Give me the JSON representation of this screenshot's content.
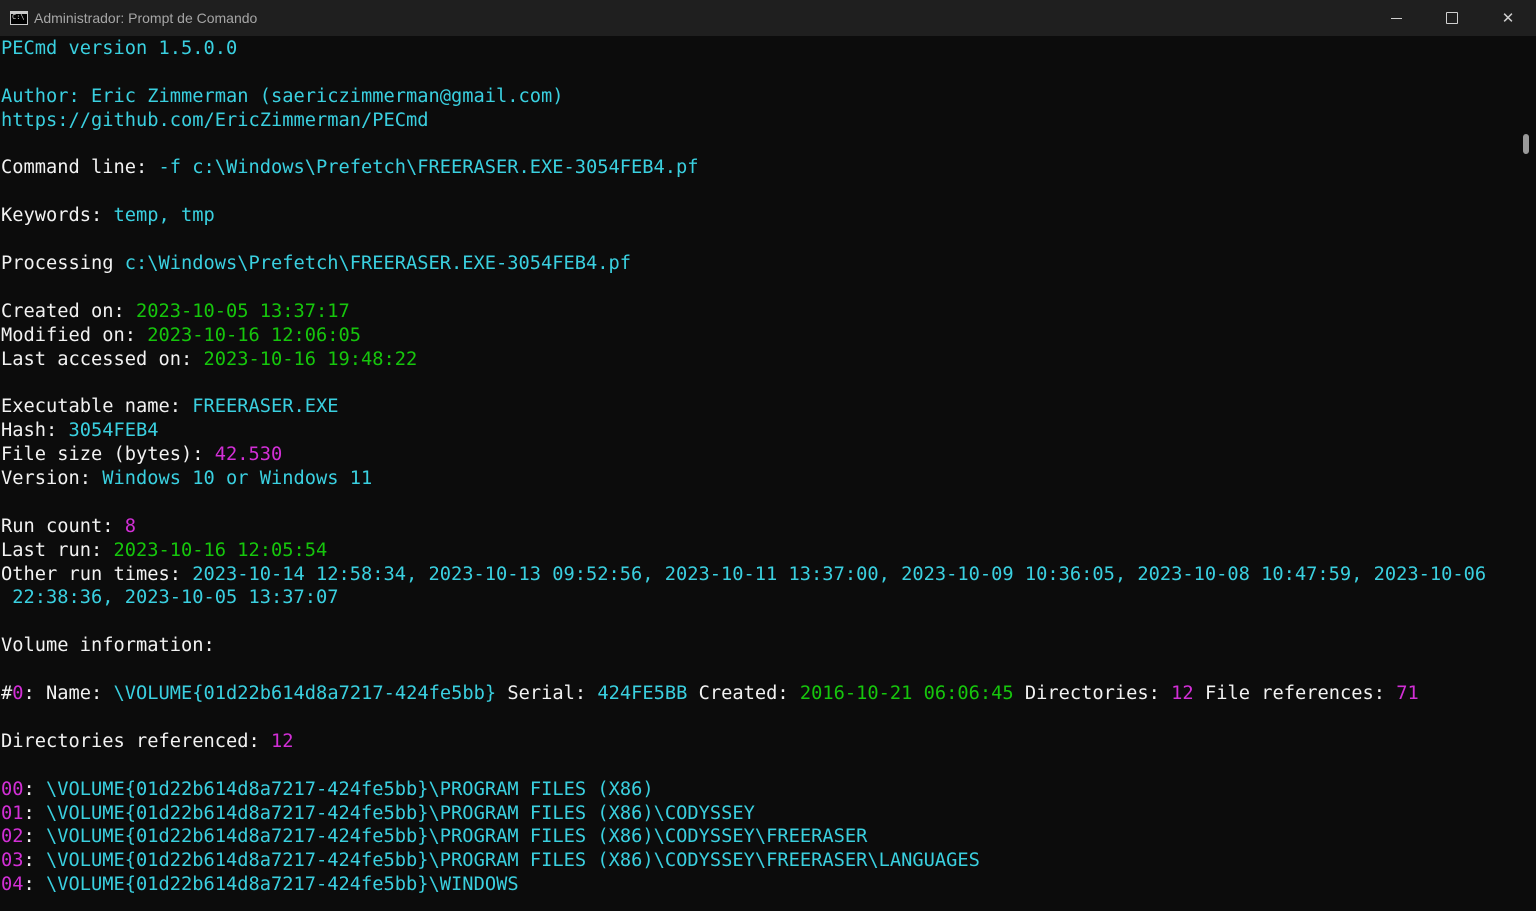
{
  "window": {
    "title": "Administrador: Prompt de Comando",
    "icon": "command-prompt-icon",
    "controls": {
      "minimize": "minimize-icon",
      "maximize": "maximize-icon",
      "close": "close-icon",
      "close_glyph": "✕"
    }
  },
  "colors": {
    "background": "#0c0c0c",
    "text": "#f2f2f2",
    "cyan": "#3ad0e0",
    "green": "#16c60c",
    "magenta": "#d22fd6"
  },
  "console": {
    "lines": [
      [
        {
          "t": "PECmd version 1.5.0.0",
          "c": "cyan"
        }
      ],
      [],
      [
        {
          "t": "Author: Eric Zimmerman (saericzimmerman@gmail.com)",
          "c": "cyan"
        }
      ],
      [
        {
          "t": "https://github.com/EricZimmerman/PECmd",
          "c": "cyan"
        }
      ],
      [],
      [
        {
          "t": "Command line: ",
          "c": "white"
        },
        {
          "t": "-f c:\\Windows\\Prefetch\\FREERASER.EXE-3054FEB4.pf",
          "c": "cyan"
        }
      ],
      [],
      [
        {
          "t": "Keywords: ",
          "c": "white"
        },
        {
          "t": "temp, tmp",
          "c": "cyan"
        }
      ],
      [],
      [
        {
          "t": "Processing ",
          "c": "white"
        },
        {
          "t": "c:\\Windows\\Prefetch\\FREERASER.EXE-3054FEB4.pf",
          "c": "cyan"
        }
      ],
      [],
      [
        {
          "t": "Created on: ",
          "c": "white"
        },
        {
          "t": "2023-10-05 13:37:17",
          "c": "green"
        }
      ],
      [
        {
          "t": "Modified on: ",
          "c": "white"
        },
        {
          "t": "2023-10-16 12:06:05",
          "c": "green"
        }
      ],
      [
        {
          "t": "Last accessed on: ",
          "c": "white"
        },
        {
          "t": "2023-10-16 19:48:22",
          "c": "green"
        }
      ],
      [],
      [
        {
          "t": "Executable name: ",
          "c": "white"
        },
        {
          "t": "FREERASER.EXE",
          "c": "cyan"
        }
      ],
      [
        {
          "t": "Hash: ",
          "c": "white"
        },
        {
          "t": "3054FEB4",
          "c": "cyan"
        }
      ],
      [
        {
          "t": "File size (bytes): ",
          "c": "white"
        },
        {
          "t": "42.530",
          "c": "magenta"
        }
      ],
      [
        {
          "t": "Version: ",
          "c": "white"
        },
        {
          "t": "Windows 10 or Windows 11",
          "c": "cyan"
        }
      ],
      [],
      [
        {
          "t": "Run count: ",
          "c": "white"
        },
        {
          "t": "8",
          "c": "magenta"
        }
      ],
      [
        {
          "t": "Last run: ",
          "c": "white"
        },
        {
          "t": "2023-10-16 12:05:54",
          "c": "green"
        }
      ],
      [
        {
          "t": "Other run times: ",
          "c": "white"
        },
        {
          "t": "2023-10-14 12:58:34, 2023-10-13 09:52:56, 2023-10-11 13:37:00, 2023-10-09 10:36:05, 2023-10-08 10:47:59, 2023-10-06",
          "c": "cyan"
        }
      ],
      [
        {
          "t": " 22:38:36, 2023-10-05 13:37:07",
          "c": "cyan"
        }
      ],
      [],
      [
        {
          "t": "Volume information:",
          "c": "white"
        }
      ],
      [],
      [
        {
          "t": "#",
          "c": "white"
        },
        {
          "t": "0",
          "c": "magenta"
        },
        {
          "t": ": Name: ",
          "c": "white"
        },
        {
          "t": "\\VOLUME{01d22b614d8a7217-424fe5bb}",
          "c": "cyan"
        },
        {
          "t": " Serial: ",
          "c": "white"
        },
        {
          "t": "424FE5BB",
          "c": "cyan"
        },
        {
          "t": " Created: ",
          "c": "white"
        },
        {
          "t": "2016-10-21 06:06:45",
          "c": "green"
        },
        {
          "t": " Directories: ",
          "c": "white"
        },
        {
          "t": "12",
          "c": "magenta"
        },
        {
          "t": " File references: ",
          "c": "white"
        },
        {
          "t": "71",
          "c": "magenta"
        }
      ],
      [],
      [
        {
          "t": "Directories referenced: ",
          "c": "white"
        },
        {
          "t": "12",
          "c": "magenta"
        }
      ],
      [],
      [
        {
          "t": "00",
          "c": "magenta"
        },
        {
          "t": ": ",
          "c": "white"
        },
        {
          "t": "\\VOLUME{01d22b614d8a7217-424fe5bb}\\PROGRAM FILES (X86)",
          "c": "cyan"
        }
      ],
      [
        {
          "t": "01",
          "c": "magenta"
        },
        {
          "t": ": ",
          "c": "white"
        },
        {
          "t": "\\VOLUME{01d22b614d8a7217-424fe5bb}\\PROGRAM FILES (X86)\\CODYSSEY",
          "c": "cyan"
        }
      ],
      [
        {
          "t": "02",
          "c": "magenta"
        },
        {
          "t": ": ",
          "c": "white"
        },
        {
          "t": "\\VOLUME{01d22b614d8a7217-424fe5bb}\\PROGRAM FILES (X86)\\CODYSSEY\\FREERASER",
          "c": "cyan"
        }
      ],
      [
        {
          "t": "03",
          "c": "magenta"
        },
        {
          "t": ": ",
          "c": "white"
        },
        {
          "t": "\\VOLUME{01d22b614d8a7217-424fe5bb}\\PROGRAM FILES (X86)\\CODYSSEY\\FREERASER\\LANGUAGES",
          "c": "cyan"
        }
      ],
      [
        {
          "t": "04",
          "c": "magenta"
        },
        {
          "t": ": ",
          "c": "white"
        },
        {
          "t": "\\VOLUME{01d22b614d8a7217-424fe5bb}\\WINDOWS",
          "c": "cyan"
        }
      ]
    ]
  }
}
